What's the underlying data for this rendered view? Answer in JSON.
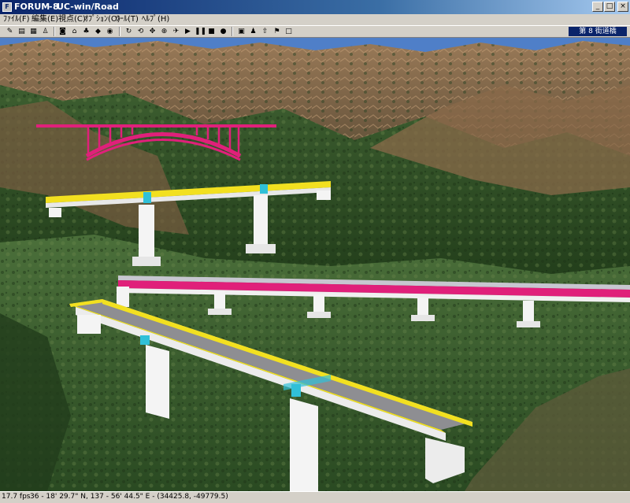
{
  "window": {
    "title_app": "FORUM 8",
    "title_sep": "-",
    "title_product": "UC-win/Road",
    "minimize": "_",
    "maximize": "□",
    "close": "×"
  },
  "menu": {
    "items": [
      "ﾌｧｲﾙ(F)",
      "編集(E)",
      "視点(C)",
      "ｵﾌﾟｼｮﾝ(O)",
      "ﾂｰﾙ(T)",
      "ﾍﾙﾌﾟ(H)"
    ]
  },
  "toolbar": {
    "station": "第 8 街道橋"
  },
  "status": {
    "fps": "17.7 fps",
    "coordinates": "36 - 18' 29.7\" N, 137 - 56' 44.5\" E - (34425.8, -49779.5)"
  },
  "colors": {
    "sky": "#4f7fc8",
    "terrain_dark": "#2c4a22",
    "terrain_brown": "#8a6a4a",
    "arch_bridge": "#e0207a",
    "deck_edge_yellow": "#f2e020",
    "pier_white": "#f4f4f4",
    "joint_cyan": "#30c0d8"
  }
}
